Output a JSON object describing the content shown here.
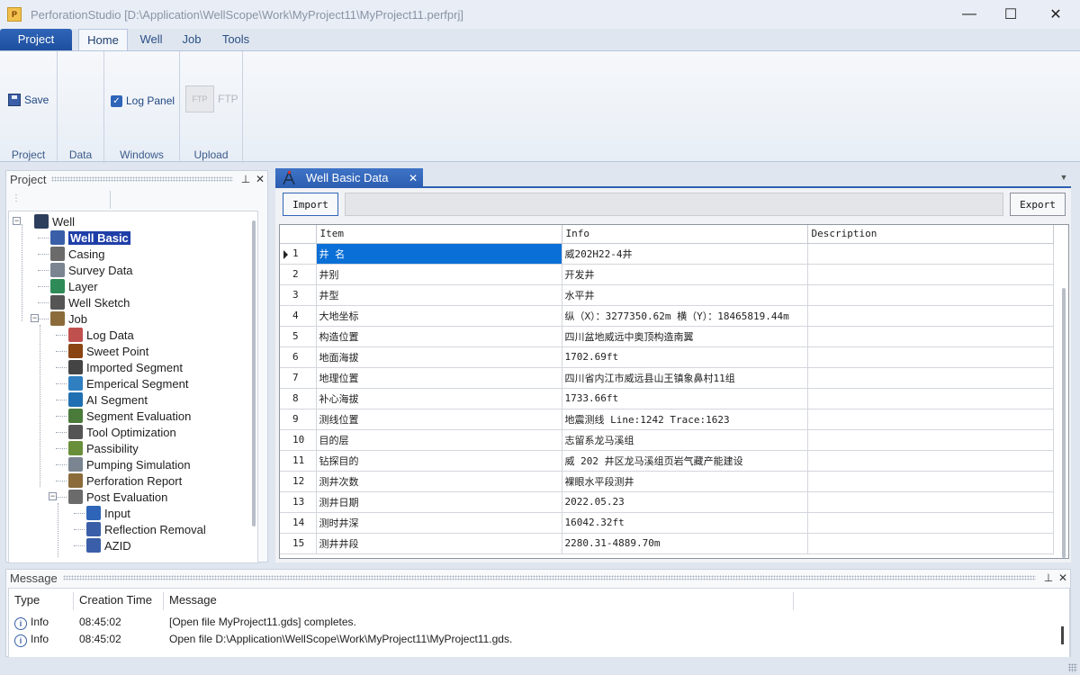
{
  "window": {
    "title": "PerforationStudio [D:\\Application\\WellScope\\Work\\MyProject11\\MyProject11.perfprj]",
    "minimize": "—",
    "maximize": "☐",
    "close": "✕"
  },
  "ribbon": {
    "tabs": [
      "Project",
      "Home",
      "Well",
      "Job",
      "Tools"
    ],
    "groups": {
      "project": {
        "label": "Project",
        "save": "Save"
      },
      "data": {
        "label": "Data"
      },
      "windows": {
        "label": "Windows",
        "log_panel": "Log Panel",
        "log_panel_checked": true
      },
      "upload": {
        "label": "Upload",
        "ftp": "FTP"
      }
    }
  },
  "project_panel": {
    "title": "Project",
    "tree": [
      {
        "label": "Well",
        "level": 0,
        "icon": "well-rig-icon"
      },
      {
        "label": "Well Basic",
        "level": 1,
        "icon": "well-basic-icon",
        "selected": true
      },
      {
        "label": "Casing",
        "level": 1,
        "icon": "casing-icon"
      },
      {
        "label": "Survey Data",
        "level": 1,
        "icon": "survey-icon"
      },
      {
        "label": "Layer",
        "level": 1,
        "icon": "layer-icon"
      },
      {
        "label": "Well Sketch",
        "level": 1,
        "icon": "sketch-icon"
      },
      {
        "label": "Job",
        "level": 1,
        "icon": "job-icon"
      },
      {
        "label": "Log Data",
        "level": 2,
        "icon": "log-data-icon"
      },
      {
        "label": "Sweet Point",
        "level": 2,
        "icon": "sweet-point-icon"
      },
      {
        "label": "Imported Segment",
        "level": 2,
        "icon": "imported-segment-icon"
      },
      {
        "label": "Emperical Segment",
        "level": 2,
        "icon": "emperical-segment-icon"
      },
      {
        "label": "AI Segment",
        "level": 2,
        "icon": "ai-segment-icon"
      },
      {
        "label": "Segment Evaluation",
        "level": 2,
        "icon": "segment-evaluation-icon"
      },
      {
        "label": "Tool Optimization",
        "level": 2,
        "icon": "tool-optimization-icon"
      },
      {
        "label": "Passibility",
        "level": 2,
        "icon": "passibility-icon"
      },
      {
        "label": "Pumping Simulation",
        "level": 2,
        "icon": "pumping-simulation-icon"
      },
      {
        "label": "Perforation Report",
        "level": 2,
        "icon": "perforation-report-icon"
      },
      {
        "label": "Post Evaluation",
        "level": 2,
        "icon": "post-evaluation-icon"
      },
      {
        "label": "Input",
        "level": 3,
        "icon": "input-icon"
      },
      {
        "label": "Reflection Removal",
        "level": 3,
        "icon": "reflection-removal-icon"
      },
      {
        "label": "AZID",
        "level": 3,
        "icon": "azid-icon"
      }
    ]
  },
  "document": {
    "tab_title": "Well Basic Data",
    "import_label": "Import",
    "export_label": "Export",
    "columns": [
      "Item",
      "Info",
      "Description"
    ],
    "rows": [
      {
        "no": "1",
        "item": "井  名",
        "info": "威202H22-4井",
        "desc": ""
      },
      {
        "no": "2",
        "item": "井别",
        "info": "开发井",
        "desc": ""
      },
      {
        "no": "3",
        "item": "井型",
        "info": "水平井",
        "desc": ""
      },
      {
        "no": "4",
        "item": "大地坐标",
        "info": "纵（X）：3277350.62m 横（Y）：18465819.44m",
        "desc": ""
      },
      {
        "no": "5",
        "item": "构造位置",
        "info": "四川盆地威远中奥顶构造南翼",
        "desc": ""
      },
      {
        "no": "6",
        "item": "地面海拔",
        "info": "1702.69ft",
        "desc": ""
      },
      {
        "no": "7",
        "item": "地理位置",
        "info": "四川省内江市威远县山王镇象鼻村11组",
        "desc": ""
      },
      {
        "no": "8",
        "item": "补心海拔",
        "info": "1733.66ft",
        "desc": ""
      },
      {
        "no": "9",
        "item": "测线位置",
        "info": "地震测线 Line:1242 Trace:1623",
        "desc": ""
      },
      {
        "no": "10",
        "item": "目的层",
        "info": "志留系龙马溪组",
        "desc": ""
      },
      {
        "no": "11",
        "item": "钻探目的",
        "info": "威 202 井区龙马溪组页岩气藏产能建设",
        "desc": ""
      },
      {
        "no": "12",
        "item": "测井次数",
        "info": "裸眼水平段测井",
        "desc": ""
      },
      {
        "no": "13",
        "item": "测井日期",
        "info": "2022.05.23",
        "desc": ""
      },
      {
        "no": "14",
        "item": "测时井深",
        "info": "16042.32ft",
        "desc": ""
      },
      {
        "no": "15",
        "item": "测井井段",
        "info": "2280.31-4889.70m",
        "desc": ""
      }
    ]
  },
  "message_panel": {
    "title": "Message",
    "columns": [
      "Type",
      "Creation Time",
      "Message"
    ],
    "rows": [
      {
        "type": "Info",
        "time": "08:45:02",
        "message": "[Open file MyProject11.gds] completes."
      },
      {
        "type": "Info",
        "time": "08:45:02",
        "message": "Open file D:\\Application\\WellScope\\Work\\MyProject11\\MyProject11.gds."
      }
    ]
  },
  "colors": {
    "accent": "#2c5fb2",
    "selection": "#0a6fd6",
    "tree_selection": "#1f3fa8"
  }
}
